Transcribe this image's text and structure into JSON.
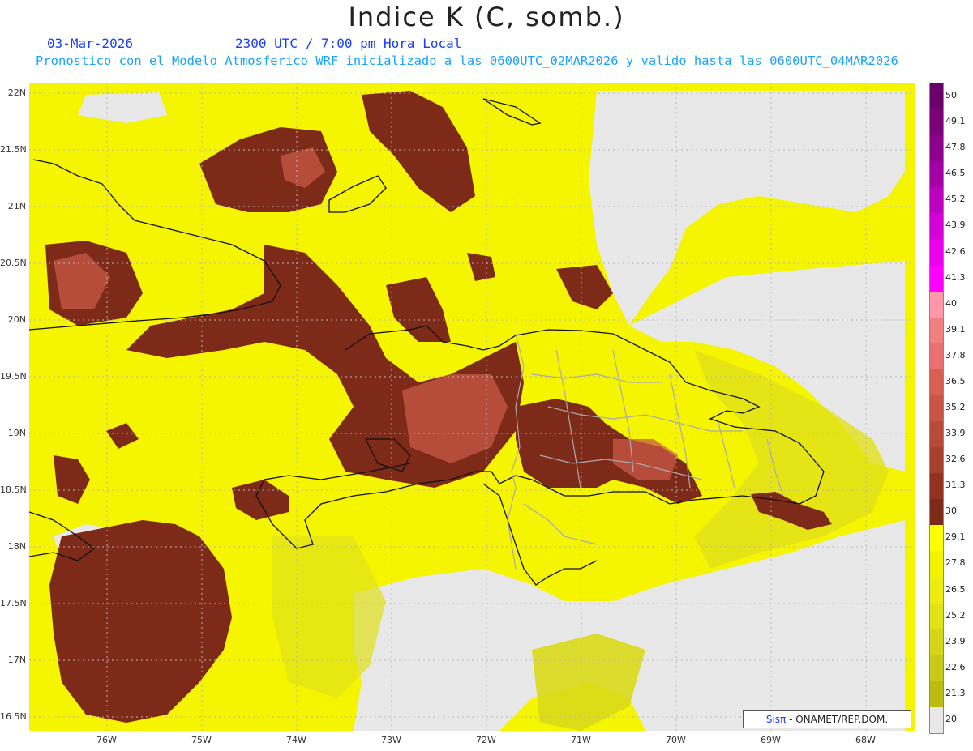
{
  "header": {
    "title": "Indice K (C, somb.)",
    "date": "03-Mar-2026",
    "time": "2300 UTC / 7:00 pm Hora Local",
    "run": "Pronostico con el Modelo Atmosferico WRF inicializado a las 0600UTC_02MAR2026 y valido hasta las  0600UTC_04MAR2026"
  },
  "axes": {
    "lat_labels": [
      "22N",
      "21.5N",
      "21N",
      "20.5N",
      "20N",
      "19.5N",
      "19N",
      "18.5N",
      "18N",
      "17.5N",
      "17N",
      "16.5N"
    ],
    "lon_labels": [
      "76W",
      "75W",
      "74W",
      "73W",
      "72W",
      "71W",
      "70W",
      "69W",
      "68W"
    ]
  },
  "colorbar": {
    "labels": [
      "50",
      "49.1",
      "47.8",
      "46.5",
      "45.2",
      "43.9",
      "42.6",
      "41.3",
      "40",
      "39.1",
      "37.8",
      "36.5",
      "35.2",
      "33.9",
      "32.6",
      "31.3",
      "30",
      "29.1",
      "27.8",
      "26.5",
      "25.2",
      "23.9",
      "22.6",
      "21.3",
      "20"
    ],
    "colors": [
      "#6b006b",
      "#7a007a",
      "#8c008c",
      "#a300a8",
      "#bb00c0",
      "#d400d8",
      "#eb00ee",
      "#ff00ff",
      "#ff99aa",
      "#f28080",
      "#e87070",
      "#d86050",
      "#c85545",
      "#b84a3a",
      "#a8402e",
      "#923221",
      "#7d2a18",
      "#ffff00",
      "#f4f200",
      "#ecec10",
      "#e2e218",
      "#d6d618",
      "#c9c918",
      "#bcbc10",
      "#e8e8e8"
    ]
  },
  "credit": {
    "sist": "Sisπ",
    "org": " - ONAMET/REP.DOM."
  },
  "map_colors": {
    "ocean_low": "#e8e8e8",
    "k_low": "#d9d91a",
    "k_mid": "#f5f500",
    "k_high": "#7d2a18",
    "k_higher": "#c85a45",
    "coast": "#111111",
    "provinces": "#aaaaaa"
  }
}
